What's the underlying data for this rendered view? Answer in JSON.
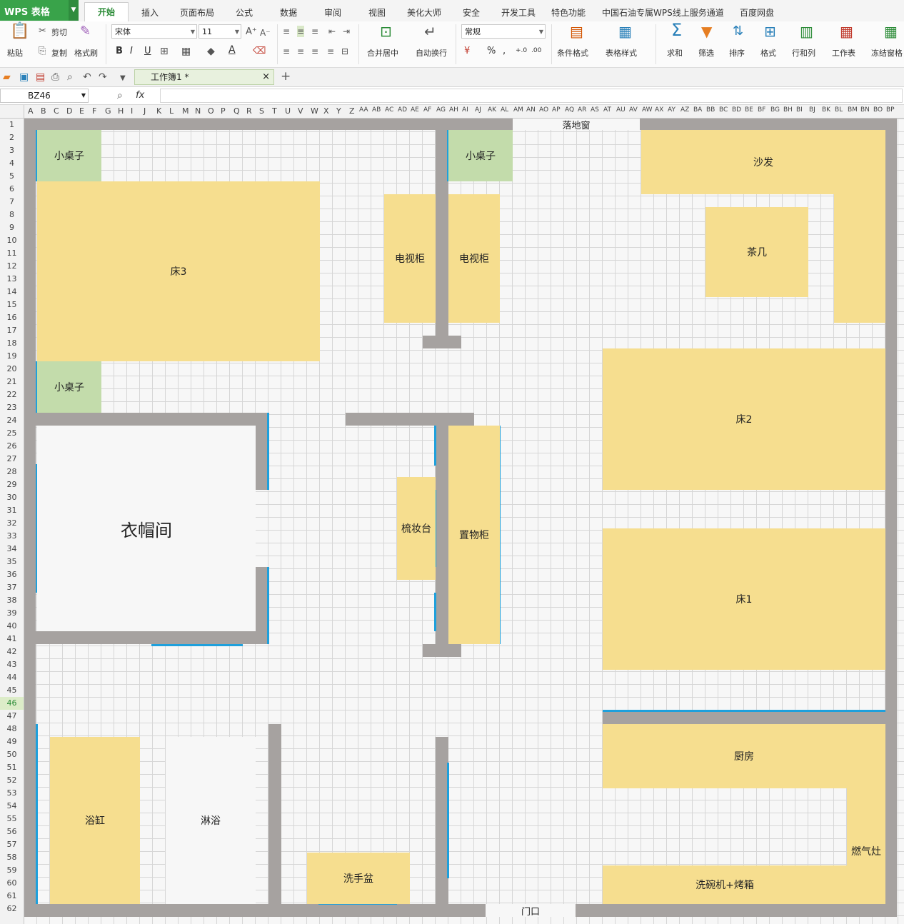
{
  "app": {
    "name": "WPS 表格"
  },
  "menu": {
    "tabs": [
      "开始",
      "插入",
      "页面布局",
      "公式",
      "数据",
      "审阅",
      "视图",
      "美化大师",
      "安全",
      "开发工具",
      "特色功能",
      "中国石油专属WPS线上服务通道",
      "百度网盘"
    ],
    "active": "开始"
  },
  "ribbon": {
    "paste": "粘贴",
    "cut": "剪切",
    "copy": "复制",
    "format_painter": "格式刷",
    "font_name": "宋体",
    "font_size": "11",
    "bold": "B",
    "italic": "I",
    "underline": "U",
    "merge_center": "合并居中",
    "wrap_text": "自动换行",
    "number_format": "常规",
    "percent": "%",
    "comma": ",",
    "inc_decimal": "+.0",
    "dec_decimal": ".00",
    "conditional_format": "条件格式",
    "table_style": "表格样式",
    "sum": "求和",
    "filter": "筛选",
    "sort": "排序",
    "format": "格式",
    "row_col": "行和列",
    "worksheet": "工作表",
    "freeze": "冻结窗格"
  },
  "document": {
    "tab_title": "工作簿1 *"
  },
  "formula": {
    "cell_ref": "BZ46",
    "fx": "fx"
  },
  "columns": [
    "A",
    "B",
    "C",
    "D",
    "E",
    "F",
    "G",
    "H",
    "I",
    "J",
    "K",
    "L",
    "M",
    "N",
    "O",
    "P",
    "Q",
    "R",
    "S",
    "T",
    "U",
    "V",
    "W",
    "X",
    "Y",
    "Z",
    "AA",
    "AB",
    "AC",
    "AD",
    "AE",
    "AF",
    "AG",
    "AH",
    "AI",
    "AJ",
    "AK",
    "AL",
    "AM",
    "AN",
    "AO",
    "AP",
    "AQ",
    "AR",
    "AS",
    "AT",
    "AU",
    "AV",
    "AW",
    "AX",
    "AY",
    "AZ",
    "BA",
    "BB",
    "BC",
    "BD",
    "BE",
    "BF",
    "BG",
    "BH",
    "BI",
    "BJ",
    "BK",
    "BL",
    "BM",
    "BN",
    "BO",
    "BP"
  ],
  "rows": {
    "count": 62,
    "selected": 46
  },
  "floorplan": {
    "window": "落地窗",
    "door": "门口",
    "items": {
      "small_table_1": "小桌子",
      "small_table_2": "小桌子",
      "small_table_3": "小桌子",
      "bed3": "床3",
      "tv_cabinet_1": "电视柜",
      "tv_cabinet_2": "电视柜",
      "sofa": "沙发",
      "tea_table": "茶几",
      "bed2": "床2",
      "bed1": "床1",
      "cloakroom": "衣帽间",
      "dresser": "梳妆台",
      "storage_cabinet": "置物柜",
      "bathtub": "浴缸",
      "shower": "淋浴",
      "wash_basin": "洗手盆",
      "kitchen": "厨房",
      "stove": "燃气灶",
      "dishwasher_oven": "洗碗机+烤箱"
    }
  }
}
